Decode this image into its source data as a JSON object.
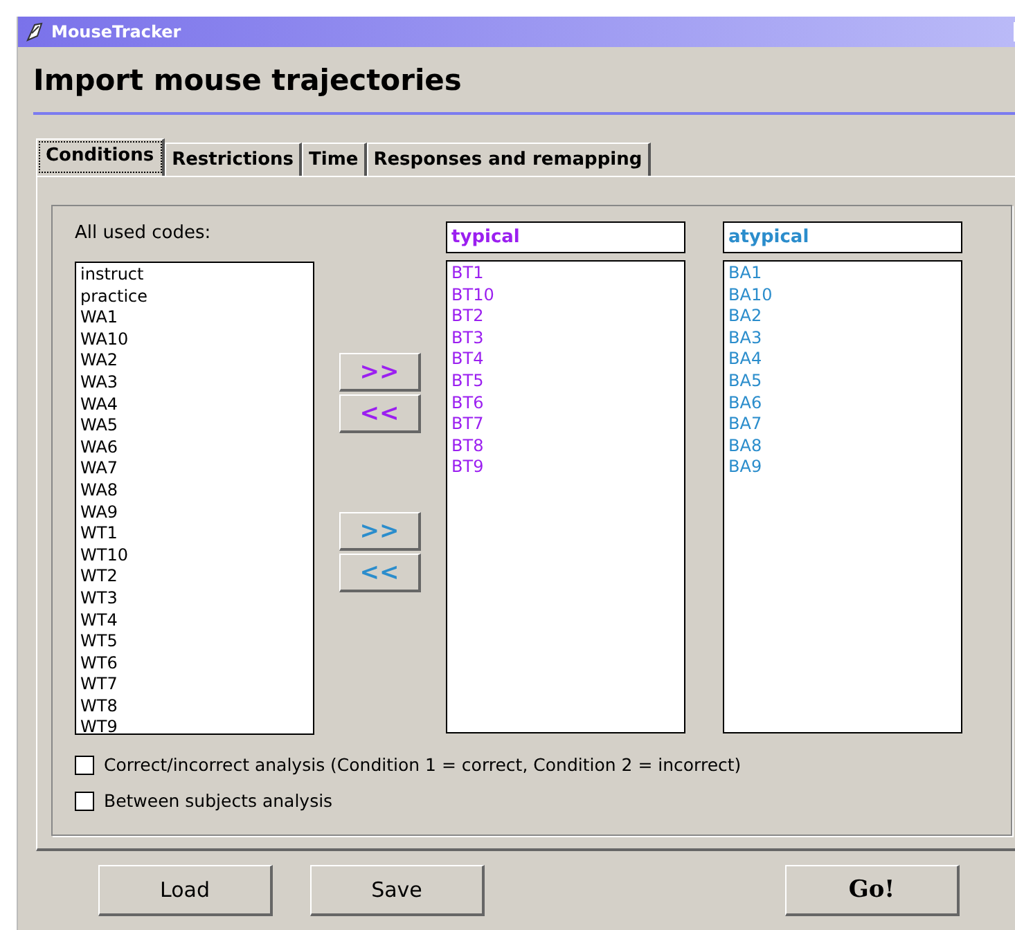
{
  "window": {
    "title": "MouseTracker"
  },
  "heading": "Import mouse trajectories",
  "tabs": [
    {
      "label": "Conditions",
      "selected": true
    },
    {
      "label": "Restrictions",
      "selected": false
    },
    {
      "label": "Time",
      "selected": false
    },
    {
      "label": "Responses and remapping",
      "selected": false
    }
  ],
  "codes": {
    "label": "All used codes:",
    "items": [
      "instruct",
      "practice",
      "WA1",
      "WA10",
      "WA2",
      "WA3",
      "WA4",
      "WA5",
      "WA6",
      "WA7",
      "WA8",
      "WA9",
      "WT1",
      "WT10",
      "WT2",
      "WT3",
      "WT4",
      "WT5",
      "WT6",
      "WT7",
      "WT8",
      "WT9"
    ]
  },
  "conditions": [
    {
      "name": "typical",
      "color": "#9b1ff0",
      "add": ">>",
      "remove": "<<",
      "items": [
        "BT1",
        "BT10",
        "BT2",
        "BT3",
        "BT4",
        "BT5",
        "BT6",
        "BT7",
        "BT8",
        "BT9"
      ]
    },
    {
      "name": "atypical",
      "color": "#2b8dcc",
      "add": ">>",
      "remove": "<<",
      "items": [
        "BA1",
        "BA10",
        "BA2",
        "BA3",
        "BA4",
        "BA5",
        "BA6",
        "BA7",
        "BA8",
        "BA9"
      ]
    }
  ],
  "options": [
    {
      "label": "Correct/incorrect analysis (Condition 1 = correct, Condition 2 = incorrect)",
      "checked": false
    },
    {
      "label": "Between subjects analysis",
      "checked": false
    }
  ],
  "buttons": [
    {
      "label": "Load",
      "kind": "normal"
    },
    {
      "label": "Save",
      "kind": "normal"
    },
    {
      "label": "Go!",
      "kind": "primary"
    }
  ]
}
